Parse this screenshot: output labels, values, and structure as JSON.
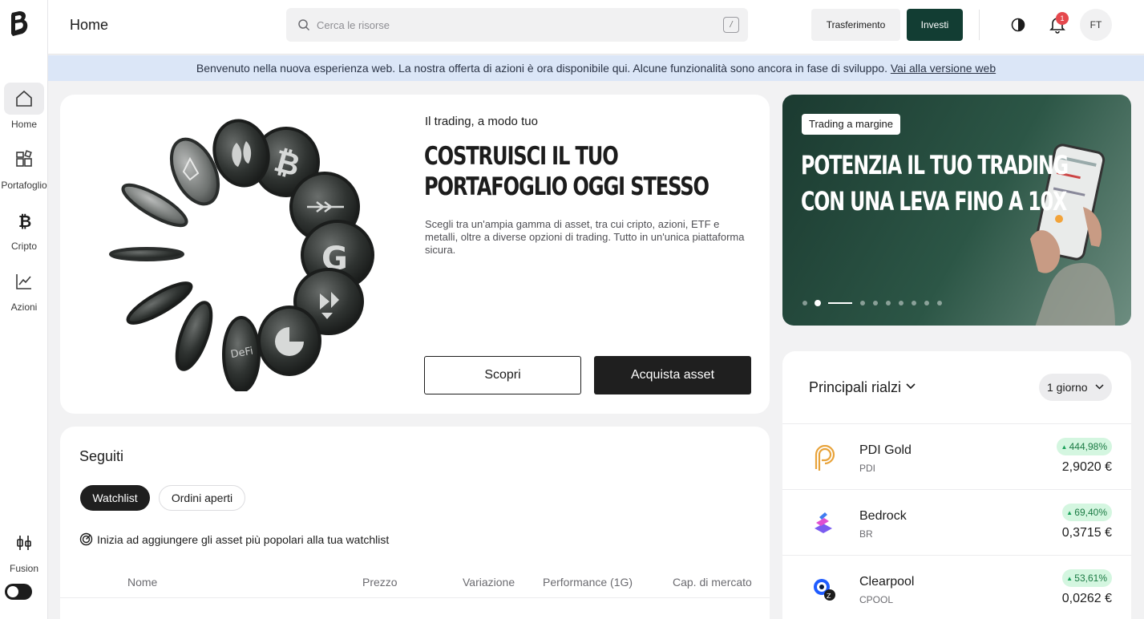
{
  "sidebar": {
    "logo": "brand-b-logo",
    "items": [
      {
        "label": "Home",
        "icon": "home-icon"
      },
      {
        "label": "Portafoglio",
        "icon": "portfolio-icon"
      },
      {
        "label": "Cripto",
        "icon": "bitcoin-icon"
      },
      {
        "label": "Azioni",
        "icon": "chart-line-icon"
      }
    ],
    "fusion": {
      "label": "Fusion",
      "icon": "candlestick-icon",
      "enabled": true
    }
  },
  "header": {
    "title": "Home",
    "search_placeholder": "Cerca le risorse",
    "search_shortcut": "/",
    "transfer_label": "Trasferimento",
    "invest_label": "Investi",
    "notification_count": "1",
    "avatar_initials": "FT"
  },
  "banner": {
    "text": "Benvenuto nella nuova esperienza web. La nostra offerta di azioni è ora disponibile qui. Alcune funzionalità sono ancora in fase di sviluppo. ",
    "link": "Vai alla versione web"
  },
  "hero": {
    "kicker": "Il trading, a modo tuo",
    "title": "COSTRUISCI IL TUO PORTAFOGLIO OGGI STESSO",
    "description": "Scegli tra un'ampia gamma di asset, tra cui cripto, azioni, ETF e metalli, oltre a diverse opzioni di trading. Tutto in un'unica piattaforma sicura.",
    "discover_label": "Scopri",
    "buy_label": "Acquista asset"
  },
  "promo": {
    "tag": "Trading a margine",
    "title": "POTENZIA IL TUO TRADING CON UNA LEVA FINO A 10X",
    "slides": 10,
    "active_slide": 2
  },
  "movers": {
    "title": "Principali rialzi",
    "period": "1 giorno",
    "items": [
      {
        "name": "PDI Gold",
        "ticker": "PDI",
        "change": "444,98%",
        "price": "2,9020 €",
        "color": "#e8a33a"
      },
      {
        "name": "Bedrock",
        "ticker": "BR",
        "change": "69,40%",
        "price": "0,3715 €",
        "color": "#7b5cf0"
      },
      {
        "name": "Clearpool",
        "ticker": "CPOOL",
        "change": "53,61%",
        "price": "0,0262 €",
        "color": "#1f5cff"
      }
    ]
  },
  "watchlist": {
    "title": "Seguiti",
    "tabs": [
      "Watchlist",
      "Ordini aperti"
    ],
    "hint": "Inizia ad aggiungere gli asset più popolari alla tua watchlist",
    "columns": [
      "Nome",
      "Prezzo",
      "Variazione",
      "Performance (1G)",
      "Cap. di mercato"
    ]
  },
  "colors": {
    "brand": "#123d33",
    "accent_green": "#18a058",
    "banner_bg": "#dbe6f7"
  }
}
